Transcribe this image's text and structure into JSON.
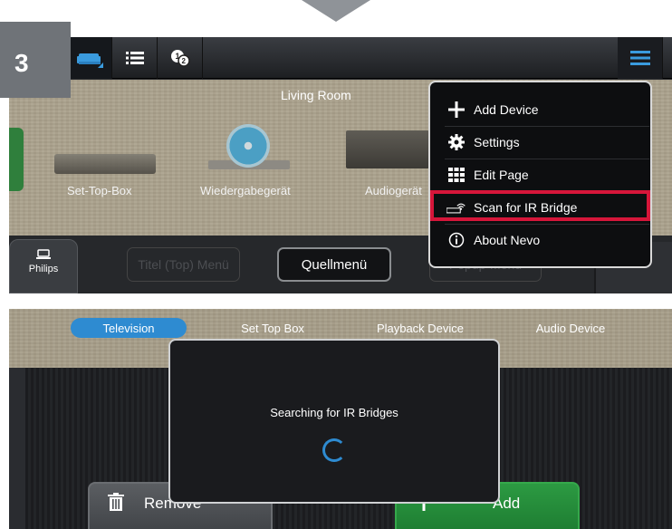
{
  "step_number": "3",
  "panel1": {
    "room_title": "Living Room",
    "devices": [
      "Set-Top-Box",
      "Wiedergabegerät",
      "Audiogerät"
    ],
    "philips_tab": "Philips",
    "buttons": {
      "titel": "Titel (Top) Menü",
      "quell": "Quellmenü",
      "popup": "Popup-Menü"
    },
    "menu": {
      "add_device": "Add Device",
      "settings": "Settings",
      "edit_page": "Edit Page",
      "scan_ir": "Scan for IR Bridge",
      "about": "About Nevo"
    }
  },
  "panel2": {
    "tabs": [
      "Television",
      "Set Top Box",
      "Playback Device",
      "Audio Device"
    ],
    "dialog_message": "Searching for IR Bridges",
    "remove_label": "Remove",
    "add_label": "Add"
  },
  "colors": {
    "accent_blue": "#2e8bd1",
    "highlight_red": "#d6163a",
    "add_green": "#2c9a42"
  }
}
